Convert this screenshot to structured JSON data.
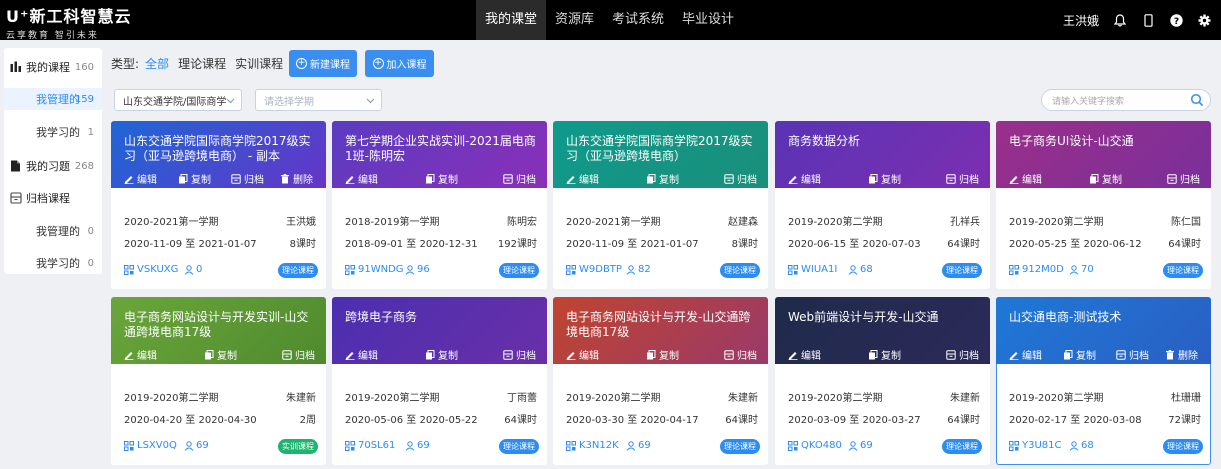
{
  "header": {
    "logo_main": "U⁺新工科智慧云",
    "logo_sub": "云享教育  智引未来",
    "nav": [
      {
        "label": "我的课堂",
        "active": true
      },
      {
        "label": "资源库",
        "active": false
      },
      {
        "label": "考试系统",
        "active": false
      },
      {
        "label": "毕业设计",
        "active": false
      }
    ],
    "username": "王洪娥",
    "icons": [
      "bell-icon",
      "phone-icon",
      "help-icon",
      "gear-icon"
    ]
  },
  "sidebar": {
    "my_courses": {
      "label": "我的课程",
      "count": "160"
    },
    "managed": {
      "label": "我管理的",
      "count": "159"
    },
    "learning": {
      "label": "我学习的",
      "count": "1"
    },
    "my_exercises": {
      "label": "我的习题",
      "count": "268"
    },
    "archived": {
      "label": "归档课程"
    },
    "archived_managed": {
      "label": "我管理的",
      "count": "0"
    },
    "archived_learning": {
      "label": "我学习的",
      "count": "0"
    }
  },
  "filter": {
    "type_label": "类型:",
    "options": [
      "全部",
      "理论课程",
      "实训课程"
    ],
    "new_course": "新建课程",
    "join_course": "加入课程",
    "school_select": "山东交通学院/国际商学院",
    "semester_placeholder": "请选择学期",
    "search_placeholder": "请输入关键字搜索"
  },
  "actions": {
    "edit": "编辑",
    "copy": "复制",
    "archive": "归档",
    "delete": "删除"
  },
  "colors": {
    "accent": "#3a8ef0",
    "practice": "#1cb56e"
  },
  "courses": [
    {
      "title": "山东交通学院国际商学院2017级实习（亚马逊跨境电商） - 副本",
      "semester": "2020-2021第一学期",
      "teacher": "王洪娥",
      "dates": "2020-11-09 至 2021-01-07",
      "hours": "8课时",
      "code": "VSKUXG",
      "students": "0",
      "type": "理论课程",
      "delete": true,
      "grad": [
        "#1e66d6",
        "#6535c7"
      ]
    },
    {
      "title": "第七学期企业实战实训-2021届电商1班-陈明宏",
      "semester": "2018-2019第一学期",
      "teacher": "陈明宏",
      "dates": "2018-09-01 至 2020-12-31",
      "hours": "192课时",
      "code": "91WNDG",
      "students": "96",
      "type": "理论课程",
      "delete": false,
      "grad": [
        "#5a3cc0",
        "#8a2fb8"
      ]
    },
    {
      "title": "山东交通学院国际商学院2017级实习（亚马逊跨境电商）",
      "semester": "2020-2021第一学期",
      "teacher": "赵建森",
      "dates": "2020-11-09 至 2021-01-07",
      "hours": "8课时",
      "code": "W9DBTP",
      "students": "82",
      "type": "理论课程",
      "delete": false,
      "grad": [
        "#0f9a8c",
        "#1a8f7a"
      ]
    },
    {
      "title": "商务数据分析",
      "semester": "2019-2020第二学期",
      "teacher": "孔祥兵",
      "dates": "2020-06-15 至 2020-07-03",
      "hours": "64课时",
      "code": "WIUA1I",
      "students": "68",
      "type": "理论课程",
      "delete": false,
      "grad": [
        "#5a33b5",
        "#7c2fb0"
      ]
    },
    {
      "title": "电子商务UI设计-山交通",
      "semester": "2019-2020第二学期",
      "teacher": "陈仁国",
      "dates": "2020-05-25 至 2020-06-12",
      "hours": "64课时",
      "code": "912M0D",
      "students": "70",
      "type": "理论课程",
      "delete": false,
      "grad": [
        "#9a2f8a",
        "#7a2f9a"
      ]
    },
    {
      "title": "电子商务网站设计与开发实训-山交通跨境电商17级",
      "semester": "2019-2020第二学期",
      "teacher": "朱建新",
      "dates": "2020-04-20 至 2020-04-30",
      "hours": "2周",
      "code": "LSXV0Q",
      "students": "69",
      "type": "实训课程",
      "delete": false,
      "grad": [
        "#6aa63a",
        "#4f8a2e"
      ]
    },
    {
      "title": "跨境电子商务",
      "semester": "2019-2020第二学期",
      "teacher": "丁雨蕾",
      "dates": "2020-05-06 至 2020-05-22",
      "hours": "64课时",
      "code": "70SL61",
      "students": "69",
      "type": "理论课程",
      "delete": false,
      "grad": [
        "#4a2fb0",
        "#6a2fa8"
      ]
    },
    {
      "title": "电子商务网站设计与开发-山交通跨境电商17级",
      "semester": "2019-2020第二学期",
      "teacher": "朱建新",
      "dates": "2020-03-30 至 2020-04-17",
      "hours": "64课时",
      "code": "K3N12K",
      "students": "69",
      "type": "理论课程",
      "delete": false,
      "grad": [
        "#c0442f",
        "#9a3a6a"
      ]
    },
    {
      "title": "Web前端设计与开发-山交通",
      "semester": "2019-2020第二学期",
      "teacher": "朱建新",
      "dates": "2020-03-09 至 2020-03-27",
      "hours": "64课时",
      "code": "QKO480",
      "students": "69",
      "type": "理论课程",
      "delete": false,
      "grad": [
        "#1f2a4a",
        "#2c2a5a"
      ]
    },
    {
      "title": "山交通电商-测试技术",
      "semester": "2019-2020第二学期",
      "teacher": "杜珊珊",
      "dates": "2020-02-17 至 2020-03-08",
      "hours": "72课时",
      "code": "Y3U81C",
      "students": "68",
      "type": "理论课程",
      "delete": true,
      "grad": [
        "#1e78d6",
        "#2a5fc4"
      ]
    }
  ]
}
